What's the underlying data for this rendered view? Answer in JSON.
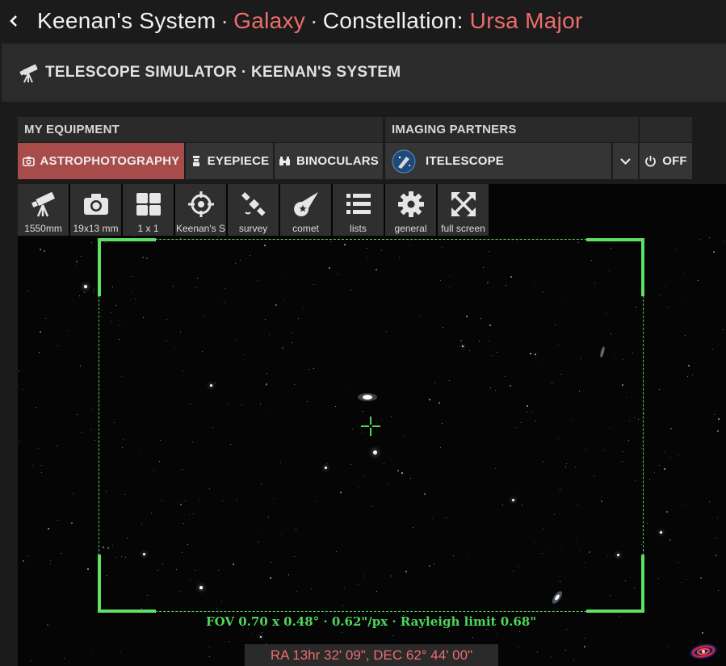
{
  "header": {
    "system": "Keenan's System",
    "sep1": "·",
    "category": "Galaxy",
    "sep2": "·",
    "constellation_label": "Constellation:",
    "constellation": "Ursa Major"
  },
  "simulator": {
    "title": "TELESCOPE SIMULATOR · KEENAN'S SYSTEM"
  },
  "equipment": {
    "my_equipment_label": "MY EQUIPMENT",
    "imaging_partners_label": "IMAGING PARTNERS",
    "modes": [
      {
        "label": "ASTROPHOTOGRAPHY",
        "icon": "camera-icon",
        "active": true
      },
      {
        "label": "EYEPIECE",
        "icon": "eyepiece-icon",
        "active": false
      },
      {
        "label": "BINOCULARS",
        "icon": "binoculars-icon",
        "active": false
      }
    ],
    "partner": {
      "label": "ITELESCOPE",
      "icon": "itelescope-logo"
    },
    "power": {
      "label": "OFF",
      "icon": "power-icon"
    }
  },
  "toolbar": [
    {
      "label": "1550mm",
      "icon": "telescope-icon"
    },
    {
      "label": "19x13 mm",
      "icon": "camera-icon"
    },
    {
      "label": "1 x 1",
      "icon": "grid-icon"
    },
    {
      "label": "Keenan's S",
      "icon": "target-icon"
    },
    {
      "label": "survey",
      "icon": "satellite-icon"
    },
    {
      "label": "comet",
      "icon": "comet-icon"
    },
    {
      "label": "lists",
      "icon": "list-icon"
    },
    {
      "label": "general",
      "icon": "gear-icon"
    },
    {
      "label": "full screen",
      "icon": "fullscreen-icon"
    }
  ],
  "view": {
    "fov_text": "FOV 0.70 x 0.48° · 0.62\"/px · Rayleigh limit 0.68\"",
    "radec": "RA 13hr 32' 09\", DEC 62° 44' 00\""
  },
  "colors": {
    "accent": "#ee6d6d",
    "active_button": "#a84b4b",
    "fov_green": "#4fd65a"
  }
}
